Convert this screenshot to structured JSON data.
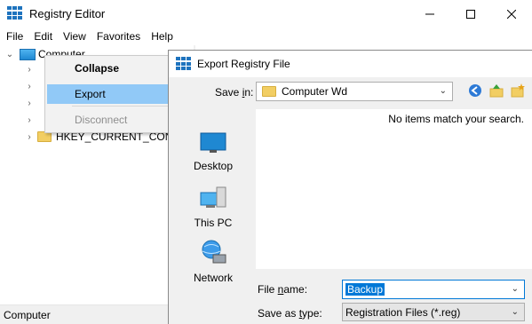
{
  "window": {
    "title": "Registry Editor",
    "controls": [
      "minimize",
      "maximize",
      "close"
    ]
  },
  "menubar": {
    "items": [
      "File",
      "Edit",
      "View",
      "Favorites",
      "Help"
    ]
  },
  "tree": {
    "root_label": "Computer",
    "visible_key": "HKEY_CURRENT_CONFI"
  },
  "context_menu": {
    "items": [
      {
        "label": "Collapse",
        "style": "bold"
      },
      {
        "label": "Export",
        "state": "selected"
      },
      {
        "label": "Disconnect",
        "state": "disabled"
      }
    ]
  },
  "statusbar": {
    "text": "Computer"
  },
  "dialog": {
    "title": "Export Registry File",
    "save_in_label_prefix": "Save ",
    "save_in_label_underlined": "i",
    "save_in_label_suffix": "n:",
    "save_in_value": "Computer Wd",
    "empty_message": "No items match your search.",
    "places": [
      "Desktop",
      "This PC",
      "Network"
    ],
    "file_name_label_prefix": "File ",
    "file_name_label_underlined": "n",
    "file_name_label_suffix": "ame:",
    "file_name_value": "Backup",
    "save_type_label_prefix": "Save as ",
    "save_type_label_underlined": "t",
    "save_type_label_suffix": "ype:",
    "save_type_value": "Registration Files (*.reg)"
  },
  "colors": {
    "accent": "#0078d7",
    "menu_highlight": "#91c9f7",
    "folder": "#f2ce63"
  }
}
